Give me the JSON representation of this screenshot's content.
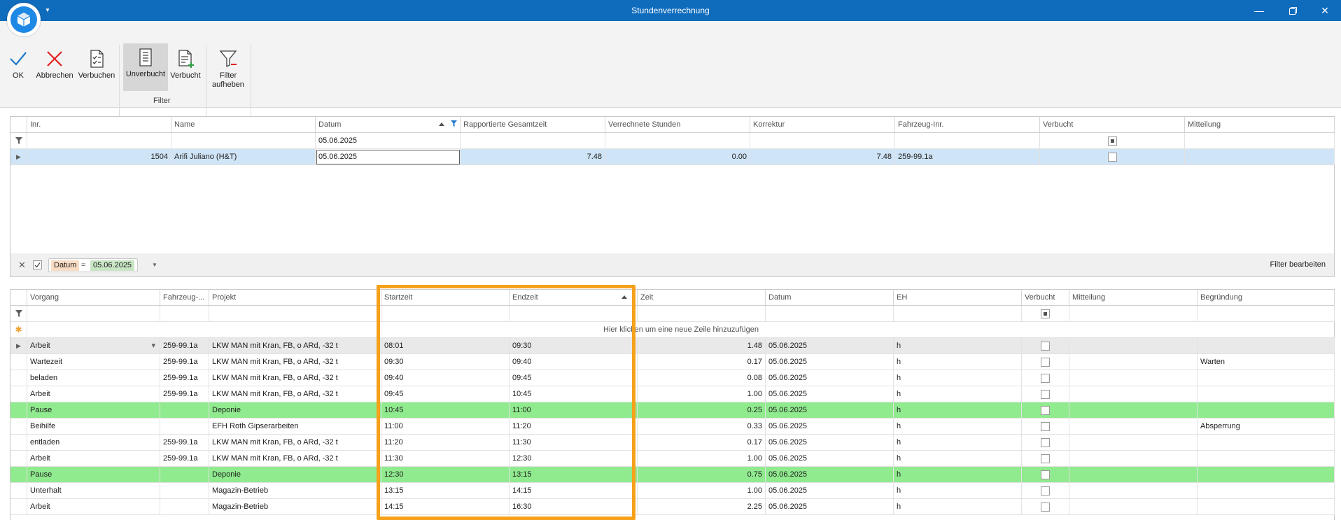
{
  "window": {
    "title": "Stundenverrechnung"
  },
  "ribbon": {
    "ok": "OK",
    "cancel": "Abbrechen",
    "book": "Verbuchen",
    "unbooked": "Unverbucht",
    "booked": "Verbucht",
    "filter_remove_1": "Filter",
    "filter_remove_2": "aufheben",
    "group_filter": "Filter"
  },
  "top_grid": {
    "headers": [
      "Inr.",
      "Name",
      "Datum",
      "Rapportierte Gesamtzeit",
      "Verrechnete Stunden",
      "Korrektur",
      "Fahrzeug-Inr.",
      "Verbucht",
      "Mitteilung"
    ],
    "filter_datum": "05.06.2025",
    "rows": [
      {
        "inr": "1504",
        "name": "Arifi Juliano (H&T)",
        "datum": "05.06.2025",
        "gesamtzeit": "7.48",
        "verrechnet": "0.00",
        "korrektur": "7.48",
        "fahrzeug": "259-99.1a",
        "verbucht": false,
        "mitteilung": ""
      }
    ]
  },
  "filterbar": {
    "field": "Datum",
    "operator": "=",
    "value": "05.06.2025",
    "edit": "Filter bearbeiten"
  },
  "bottom_grid": {
    "headers": [
      "Vorgang",
      "Fahrzeug-...",
      "Projekt",
      "Startzeit",
      "Endzeit",
      "Zeit",
      "Datum",
      "EH",
      "Verbucht",
      "Mitteilung",
      "Begründung"
    ],
    "new_row_hint": "Hier klicken um eine neue Zeile hinzuzufügen",
    "rows": [
      {
        "vorgang": "Arbeit",
        "fahrzeug": "259-99.1a",
        "projekt": "LKW MAN mit Kran, FB, o ARd, -32 t",
        "start": "08:01",
        "ende": "09:30",
        "zeit": "1.48",
        "datum": "05.06.2025",
        "eh": "h",
        "mitteilung": "",
        "begruendung": "",
        "type": "current"
      },
      {
        "vorgang": "Wartezeit",
        "fahrzeug": "259-99.1a",
        "projekt": "LKW MAN mit Kran, FB, o ARd, -32 t",
        "start": "09:30",
        "ende": "09:40",
        "zeit": "0.17",
        "datum": "05.06.2025",
        "eh": "h",
        "mitteilung": "",
        "begruendung": "Warten",
        "type": "normal"
      },
      {
        "vorgang": "beladen",
        "fahrzeug": "259-99.1a",
        "projekt": "LKW MAN mit Kran, FB, o ARd, -32 t",
        "start": "09:40",
        "ende": "09:45",
        "zeit": "0.08",
        "datum": "05.06.2025",
        "eh": "h",
        "mitteilung": "",
        "begruendung": "",
        "type": "normal"
      },
      {
        "vorgang": "Arbeit",
        "fahrzeug": "259-99.1a",
        "projekt": "LKW MAN mit Kran, FB, o ARd, -32 t",
        "start": "09:45",
        "ende": "10:45",
        "zeit": "1.00",
        "datum": "05.06.2025",
        "eh": "h",
        "mitteilung": "",
        "begruendung": "",
        "type": "normal"
      },
      {
        "vorgang": "Pause",
        "fahrzeug": "",
        "projekt": "Deponie",
        "start": "10:45",
        "ende": "11:00",
        "zeit": "0.25",
        "datum": "05.06.2025",
        "eh": "h",
        "mitteilung": "",
        "begruendung": "",
        "type": "pause"
      },
      {
        "vorgang": "Beihilfe",
        "fahrzeug": "",
        "projekt": "EFH Roth Gipserarbeiten",
        "start": "11:00",
        "ende": "11:20",
        "zeit": "0.33",
        "datum": "05.06.2025",
        "eh": "h",
        "mitteilung": "",
        "begruendung": "Absperrung",
        "type": "normal"
      },
      {
        "vorgang": "entladen",
        "fahrzeug": "259-99.1a",
        "projekt": "LKW MAN mit Kran, FB, o ARd, -32 t",
        "start": "11:20",
        "ende": "11:30",
        "zeit": "0.17",
        "datum": "05.06.2025",
        "eh": "h",
        "mitteilung": "",
        "begruendung": "",
        "type": "normal"
      },
      {
        "vorgang": "Arbeit",
        "fahrzeug": "259-99.1a",
        "projekt": "LKW MAN mit Kran, FB, o ARd, -32 t",
        "start": "11:30",
        "ende": "12:30",
        "zeit": "1.00",
        "datum": "05.06.2025",
        "eh": "h",
        "mitteilung": "",
        "begruendung": "",
        "type": "normal"
      },
      {
        "vorgang": "Pause",
        "fahrzeug": "",
        "projekt": "Deponie",
        "start": "12:30",
        "ende": "13:15",
        "zeit": "0.75",
        "datum": "05.06.2025",
        "eh": "h",
        "mitteilung": "",
        "begruendung": "",
        "type": "pause"
      },
      {
        "vorgang": "Unterhalt",
        "fahrzeug": "",
        "projekt": "Magazin-Betrieb",
        "start": "13:15",
        "ende": "14:15",
        "zeit": "1.00",
        "datum": "05.06.2025",
        "eh": "h",
        "mitteilung": "",
        "begruendung": "",
        "type": "normal"
      },
      {
        "vorgang": "Arbeit",
        "fahrzeug": "",
        "projekt": "Magazin-Betrieb",
        "start": "14:15",
        "ende": "16:30",
        "zeit": "2.25",
        "datum": "05.06.2025",
        "eh": "h",
        "mitteilung": "",
        "begruendung": "",
        "type": "normal"
      }
    ]
  }
}
